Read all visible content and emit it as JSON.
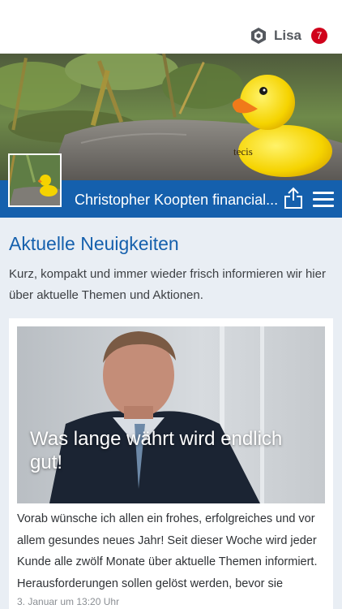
{
  "header": {
    "user_name": "Lisa",
    "notification_count": "7",
    "user_icon": "hexagon-profile-icon"
  },
  "profile": {
    "company_name": "Christopher Koopten financial...",
    "share_icon": "share-icon",
    "menu_icon": "hamburger-menu-icon",
    "hero_brand_text": "tecis"
  },
  "news": {
    "title": "Aktuelle Neuigkeiten",
    "description": "Kurz, kompakt und immer wieder frisch informieren wir hier über aktuelle Themen und Aktionen."
  },
  "article": {
    "headline": "Was lange währt wird endlich gut!",
    "excerpt": "Vorab wünsche ich allen ein frohes, erfolgreiches und vor allem gesundes neues Jahr! Seit dieser Woche wird jeder Kunde alle zwölf Monate über aktuelle Themen informiert. Herausforderungen sollen gelöst werden, bevor sie",
    "date": "3. Januar um 13:20 Uhr"
  },
  "colors": {
    "brand_blue": "#1560ad",
    "badge_red": "#d0021b",
    "background": "#e9eef4"
  }
}
